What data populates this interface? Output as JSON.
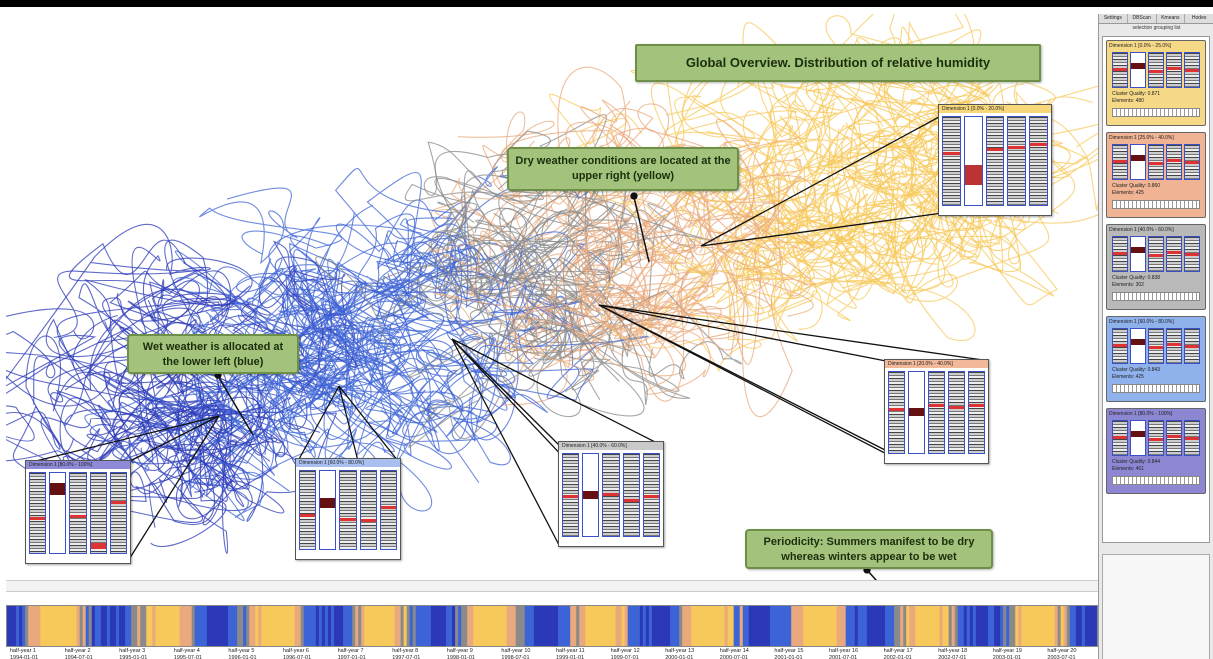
{
  "banner_title": "Global Overview. Distribution of relative humidity",
  "callouts": {
    "dry": [
      "Dry weather conditions are located at the",
      "upper right (yellow)"
    ],
    "wet": [
      "Wet weather is allocated at",
      "the lower left (blue)"
    ],
    "periodicity": [
      "Periodicity: Summers manifest to be dry",
      "whereas winters appear to be wet"
    ]
  },
  "sidebar": {
    "tabs": [
      "Settings",
      "DBScan",
      "Kmeans",
      "Hodes"
    ],
    "caption": "selection grouping list",
    "clusters": [
      {
        "title": "Dimension 1 [0.0% - 25.0%]",
        "quality": "Cluster Quality:  0.871",
        "elements": "Elements:  480",
        "color": "#f6d987"
      },
      {
        "title": "Dimension 1 [25.0% - 40.0%]",
        "quality": "Cluster Quality:  0.860",
        "elements": "Elements:  425",
        "color": "#f0b393"
      },
      {
        "title": "Dimension 1 [40.0% - 60.0%]",
        "quality": "Cluster Quality:  0.838",
        "elements": "Elements:  302",
        "color": "#b9b9b9"
      },
      {
        "title": "Dimension 1 [60.0% - 80.0%]",
        "quality": "Cluster Quality:  0.843",
        "elements": "Elements:  425",
        "color": "#8fb1ec"
      },
      {
        "title": "Dimension 1 [80.0% - 100%]",
        "quality": "Cluster Quality:  0.844",
        "elements": "Elements:  461",
        "color": "#8d87d3"
      }
    ]
  },
  "panels": [
    {
      "title": "Dimension 1 [0.0% - 20.0%]",
      "color": "#f7d779"
    },
    {
      "title": "Dimension 1 [20.0% - 40.0%]",
      "color": "#f2b89a"
    },
    {
      "title": "Dimension 1 [40.0% - 60.0%]",
      "color": "#c9c9c9"
    },
    {
      "title": "Dimension 1 [60.0% - 80.0%]",
      "color": "#a9bff0"
    },
    {
      "title": "Dimension 1 [80.0% - 100%]",
      "color": "#8f8ad8"
    }
  ],
  "timeline": {
    "ticks": [
      {
        "label": "half-year 1",
        "date": "1994-01-01"
      },
      {
        "label": "half-year 2",
        "date": "1994-07-01"
      },
      {
        "label": "half-year 3",
        "date": "1995-01-01"
      },
      {
        "label": "half-year 4",
        "date": "1995-07-01"
      },
      {
        "label": "half-year 5",
        "date": "1996-01-01"
      },
      {
        "label": "half-year 6",
        "date": "1996-07-01"
      },
      {
        "label": "half-year 7",
        "date": "1997-01-01"
      },
      {
        "label": "half-year 8",
        "date": "1997-07-01"
      },
      {
        "label": "half-year 9",
        "date": "1998-01-01"
      },
      {
        "label": "half-year 10",
        "date": "1998-07-01"
      },
      {
        "label": "half-year 11",
        "date": "1999-01-01"
      },
      {
        "label": "half-year 12",
        "date": "1999-07-01"
      },
      {
        "label": "half-year 13",
        "date": "2000-01-01"
      },
      {
        "label": "half-year 14",
        "date": "2000-07-01"
      },
      {
        "label": "half-year 15",
        "date": "2001-01-01"
      },
      {
        "label": "half-year 16",
        "date": "2001-07-01"
      },
      {
        "label": "half-year 17",
        "date": "2002-01-01"
      },
      {
        "label": "half-year 18",
        "date": "2002-07-01"
      },
      {
        "label": "half-year 19",
        "date": "2003-01-01"
      },
      {
        "label": "half-year 20",
        "date": "2003-07-01"
      }
    ]
  },
  "colors": {
    "dry": "#f7c85a",
    "transition": "#e9a97c",
    "neutral": "#8a8a8a",
    "wet": "#3d64d6",
    "very_wet": "#2b39b8",
    "callout_fill": "#a3c37c"
  }
}
